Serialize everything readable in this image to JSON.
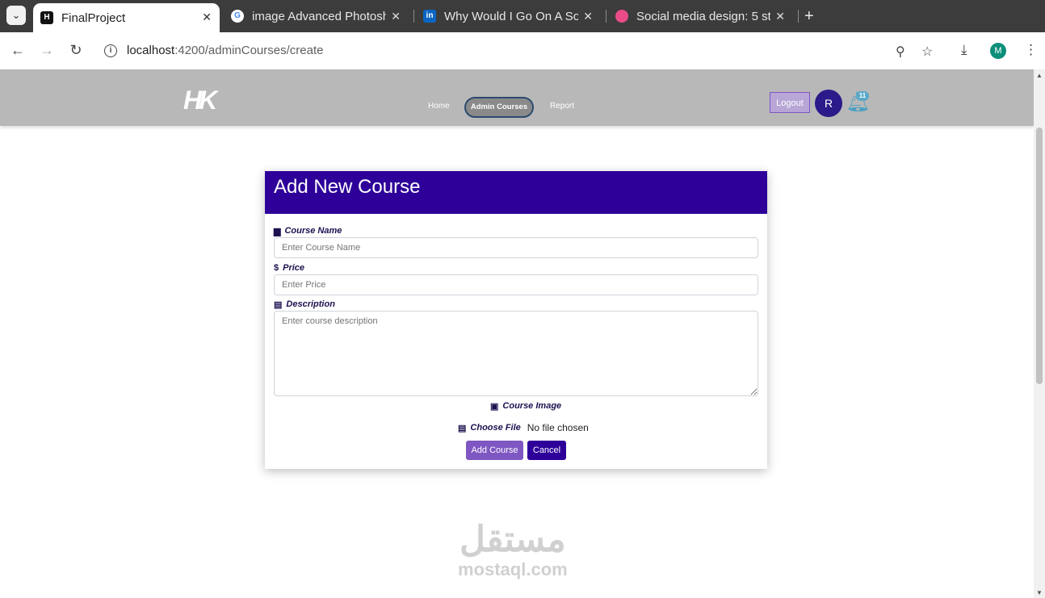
{
  "browser": {
    "tabs": [
      {
        "title": "FinalProject",
        "favicon": "H",
        "active": true
      },
      {
        "title": "image Advanced Photosh",
        "favicon": "G",
        "active": false
      },
      {
        "title": "Why Would I Go On A So",
        "favicon": "in",
        "active": false
      },
      {
        "title": "Social media design: 5 st",
        "favicon": "dribbble",
        "active": false
      }
    ],
    "url_host": "localhost",
    "url_path": ":4200/adminCourses/create",
    "profile_initial": "M"
  },
  "nav": {
    "logo": "HK",
    "links": [
      {
        "label": "Home"
      },
      {
        "label": "Admin Courses"
      },
      {
        "label": "Report"
      }
    ],
    "logout": "Logout",
    "avatar_text": "R",
    "notification_count": "11"
  },
  "form": {
    "title": "Add New Course",
    "course_name_label": "Course Name",
    "course_name_placeholder": "Enter Course Name",
    "price_label": "Price",
    "price_placeholder": "Enter Price",
    "description_label": "Description",
    "description_placeholder": "Enter course description",
    "image_label": "Course Image",
    "choose_file_label": "Choose File",
    "file_status": "No file chosen",
    "add_button": "Add Course",
    "cancel_button": "Cancel"
  },
  "watermark": {
    "arabic": "مستقل",
    "latin": "mostaql.com"
  },
  "colors": {
    "header": "#2e0099",
    "accent": "#7e57c2",
    "navbar": "#b8b8b8"
  }
}
